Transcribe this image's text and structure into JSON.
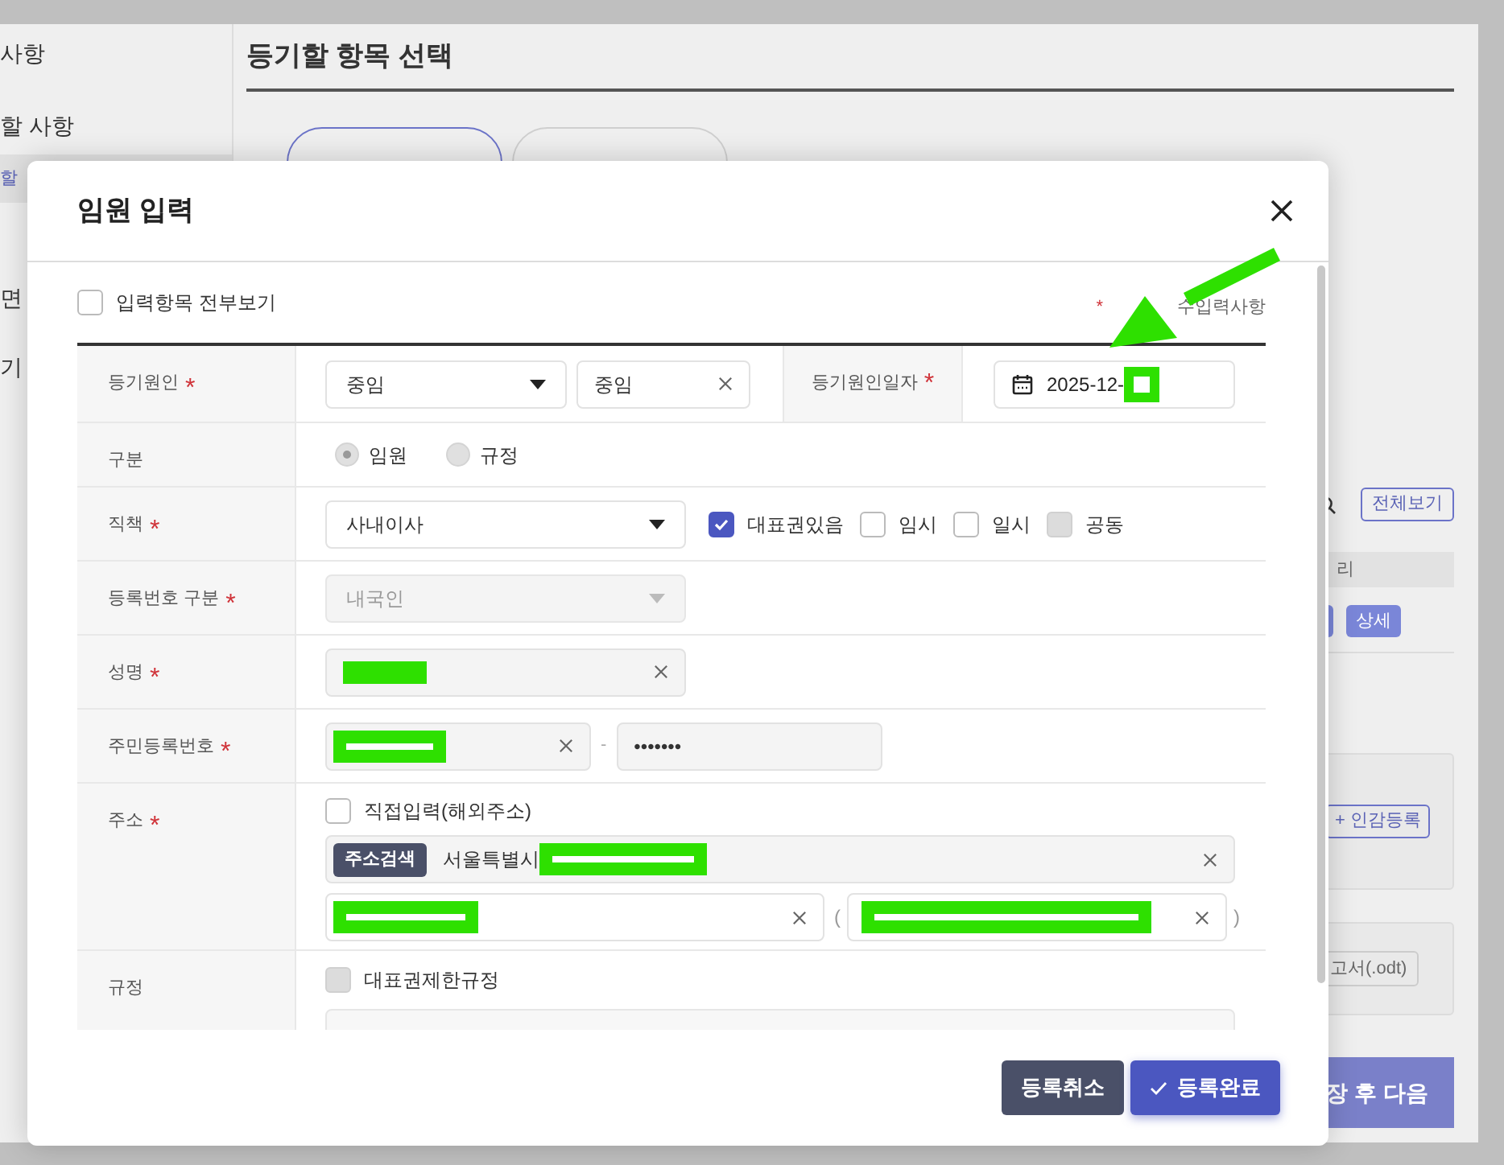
{
  "sidebar": [
    {
      "label": "사항",
      "selected": false
    },
    {
      "label": "할 사항",
      "selected": false
    },
    {
      "label": "할",
      "selected": true
    },
    {
      "label": "면",
      "selected": false
    },
    {
      "label": "기",
      "selected": false
    }
  ],
  "main": {
    "title": "등기할 항목 선택",
    "tabs": [
      {
        "selected": true
      },
      {
        "selected": false
      }
    ]
  },
  "right_panel": {
    "view_all_button": "전체보기",
    "column_header": "리",
    "detail_button": "상세",
    "seal_button": "+ 인감등록",
    "report_button": "고서(.odt)",
    "next_button": "장 후 다음"
  },
  "dialog": {
    "title": "임원 입력",
    "show_all": {
      "label": "입력항목 전부보기",
      "checked": false
    },
    "required_note_mark": "*",
    "required_note": "수입력사항",
    "rows": [
      {
        "kind": "cause",
        "label": "등기원인",
        "required_mark": "*",
        "select_value": "중임",
        "text_value": "중임",
        "date_label": "등기원인일자",
        "date_required_mark": "*",
        "date_value": "2025-12-",
        "date_redacted": true
      },
      {
        "kind": "radio",
        "label": "구분",
        "options": [
          {
            "label": "임원",
            "selected": true
          },
          {
            "label": "규정",
            "selected": false
          }
        ]
      },
      {
        "kind": "position",
        "label": "직책",
        "required_mark": "*",
        "select_value": "사내이사",
        "checks": [
          {
            "label": "대표권있음",
            "checked": true,
            "disabled": false
          },
          {
            "label": "임시",
            "checked": false,
            "disabled": false
          },
          {
            "label": "일시",
            "checked": false,
            "disabled": false
          },
          {
            "label": "공동",
            "checked": false,
            "disabled": true
          }
        ]
      },
      {
        "kind": "select",
        "label": "등록번호 구분",
        "required_mark": "*",
        "value": "내국인",
        "disabled": true
      },
      {
        "kind": "text",
        "label": "성명",
        "required_mark": "*",
        "redacted": true
      },
      {
        "kind": "rrn",
        "label": "주민등록번호",
        "required_mark": "*",
        "first": {
          "redacted": true
        },
        "separator": "-",
        "second": {
          "value": "•••••••"
        }
      },
      {
        "kind": "address",
        "label": "주소",
        "required_mark": "*",
        "check": {
          "label": "직접입력(해외주소)",
          "checked": false
        },
        "search_button": "주소검색",
        "line1": {
          "value": "서울특별시",
          "redacted": true
        },
        "line2": {
          "redacted": true
        },
        "open_paren": "(",
        "line3": {
          "redacted": true
        },
        "close_paren": ")"
      },
      {
        "kind": "rule",
        "label": "규정",
        "check": {
          "label": "대표권제한규정",
          "checked": false,
          "disabled": true
        }
      }
    ],
    "buttons": [
      {
        "label": "등록취소",
        "kind": "cancel"
      },
      {
        "label": "등록완료",
        "kind": "confirm"
      }
    ]
  },
  "annotation": {
    "kind": "arrow"
  }
}
